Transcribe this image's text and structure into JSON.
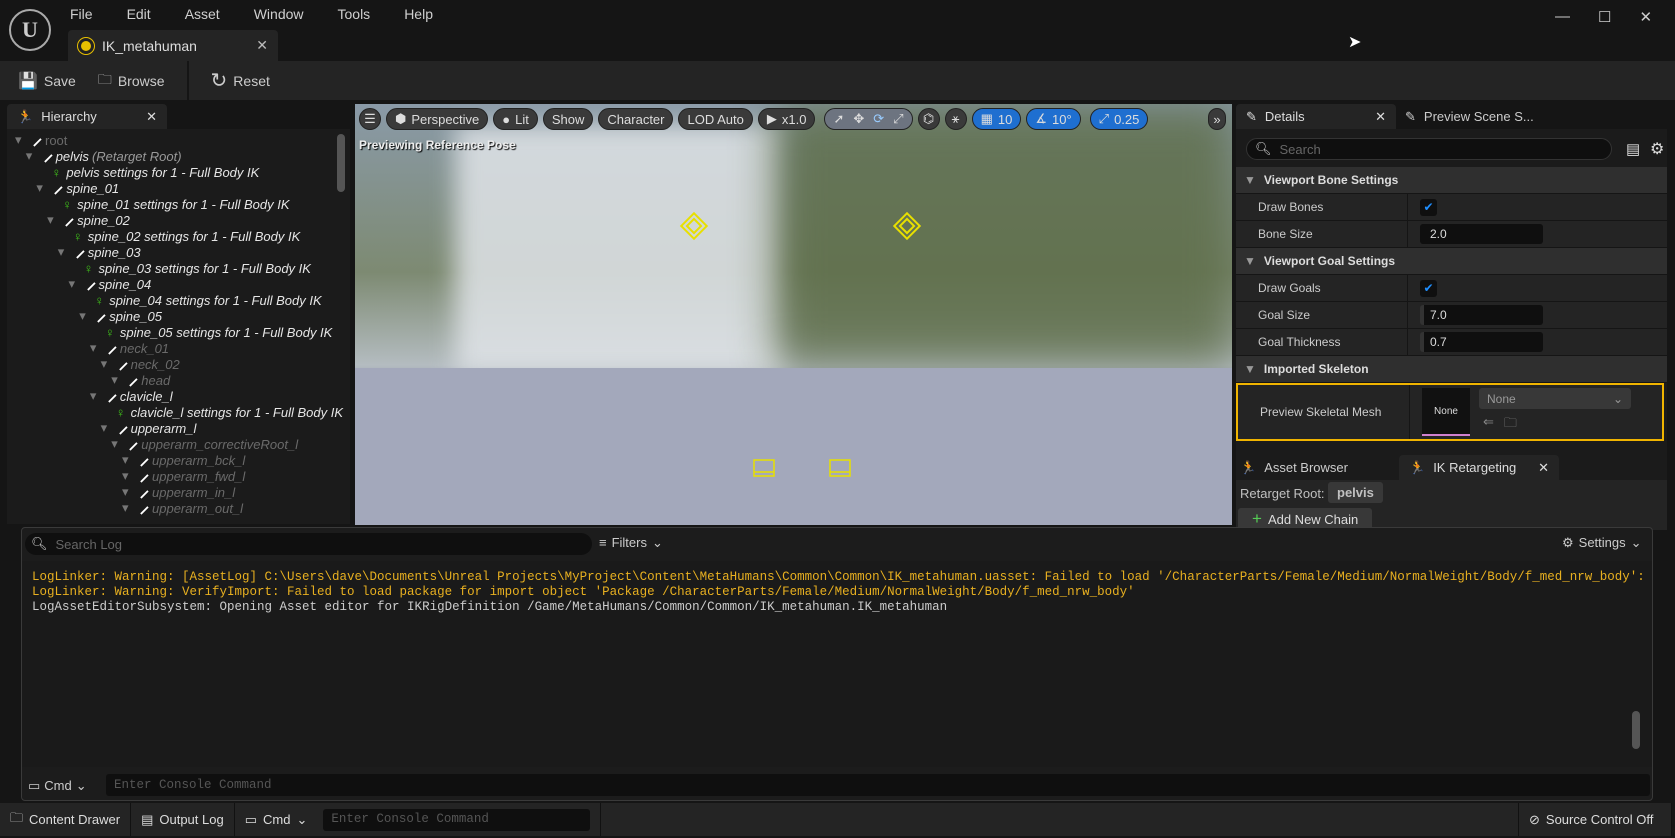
{
  "app": {
    "menu": [
      "File",
      "Edit",
      "Asset",
      "Window",
      "Tools",
      "Help"
    ],
    "tab_title": "IK_metahuman"
  },
  "toolbar": {
    "save": "Save",
    "browse": "Browse",
    "reset": "Reset"
  },
  "hierarchy": {
    "title": "Hierarchy",
    "items": [
      {
        "label": "root",
        "level": 0,
        "type": "bone",
        "dim": true,
        "style": "normal"
      },
      {
        "label": "pelvis",
        "suffix": "(Retarget Root)",
        "level": 1,
        "type": "bone"
      },
      {
        "label": "pelvis settings for 1 - Full Body IK",
        "level": 2,
        "type": "goal"
      },
      {
        "label": "spine_01",
        "level": 2,
        "type": "bone"
      },
      {
        "label": "spine_01 settings for 1 - Full Body IK",
        "level": 3,
        "type": "goal"
      },
      {
        "label": "spine_02",
        "level": 3,
        "type": "bone"
      },
      {
        "label": "spine_02 settings for 1 - Full Body IK",
        "level": 4,
        "type": "goal"
      },
      {
        "label": "spine_03",
        "level": 4,
        "type": "bone"
      },
      {
        "label": "spine_03 settings for 1 - Full Body IK",
        "level": 5,
        "type": "goal"
      },
      {
        "label": "spine_04",
        "level": 5,
        "type": "bone"
      },
      {
        "label": "spine_04 settings for 1 - Full Body IK",
        "level": 6,
        "type": "goal"
      },
      {
        "label": "spine_05",
        "level": 6,
        "type": "bone"
      },
      {
        "label": "spine_05 settings for 1 - Full Body IK",
        "level": 7,
        "type": "goal"
      },
      {
        "label": "neck_01",
        "level": 7,
        "type": "bone",
        "dim": true
      },
      {
        "label": "neck_02",
        "level": 8,
        "type": "bone",
        "dim": true
      },
      {
        "label": "head",
        "level": 9,
        "type": "bone",
        "dim": true
      },
      {
        "label": "clavicle_l",
        "level": 7,
        "type": "bone"
      },
      {
        "label": "clavicle_l settings for 1 - Full Body IK",
        "level": 8,
        "type": "goal"
      },
      {
        "label": "upperarm_l",
        "level": 8,
        "type": "bone"
      },
      {
        "label": "upperarm_correctiveRoot_l",
        "level": 9,
        "type": "bone",
        "dim": true
      },
      {
        "label": "upperarm_bck_l",
        "level": 10,
        "type": "bone",
        "dim": true
      },
      {
        "label": "upperarm_fwd_l",
        "level": 10,
        "type": "bone",
        "dim": true
      },
      {
        "label": "upperarm_in_l",
        "level": 10,
        "type": "bone",
        "dim": true
      },
      {
        "label": "upperarm_out_l",
        "level": 10,
        "type": "bone",
        "dim": true
      }
    ]
  },
  "viewport": {
    "perspective": "Perspective",
    "lit": "Lit",
    "show": "Show",
    "character": "Character",
    "lod": "LOD Auto",
    "speed": "x1.0",
    "grid_snap": "10",
    "rot_snap": "10°",
    "scale_snap": "0.25",
    "overlay": "Previewing Reference Pose",
    "gizmo_color": "#e8e000"
  },
  "details": {
    "tab": "Details",
    "tab2": "Preview Scene S...",
    "search_placeholder": "Search",
    "sections": {
      "bone": "Viewport Bone Settings",
      "goal": "Viewport Goal Settings",
      "skel": "Imported Skeleton"
    },
    "draw_bones": {
      "label": "Draw Bones",
      "checked": true
    },
    "bone_size": {
      "label": "Bone Size",
      "value": "2.0"
    },
    "draw_goals": {
      "label": "Draw Goals",
      "checked": true
    },
    "goal_size": {
      "label": "Goal Size",
      "value": "7.0"
    },
    "goal_thickness": {
      "label": "Goal Thickness",
      "value": "0.7"
    },
    "preview_mesh": {
      "label": "Preview Skeletal Mesh",
      "thumb": "None",
      "value": "None"
    },
    "highlight_color": "#f0b400"
  },
  "retarget": {
    "tab1": "Asset Browser",
    "tab2": "IK Retargeting",
    "root_label": "Retarget Root:",
    "root_value": "pelvis",
    "add_chain": "Add New Chain"
  },
  "output_log": {
    "search_placeholder": "Search Log",
    "filters": "Filters",
    "settings": "Settings",
    "lines": [
      {
        "text": "LogLinker: Warning: [AssetLog] C:\\Users\\dave\\Documents\\Unreal Projects\\MyProject\\Content\\MetaHumans\\Common\\Common\\IK_metahuman.uasset: Failed to load '/CharacterParts/Female/Medium/NormalWeight/Body/f_med_nrw_body': Can't find f:",
        "level": "warning"
      },
      {
        "text": "LogLinker: Warning: VerifyImport: Failed to load package for import object 'Package /CharacterParts/Female/Medium/NormalWeight/Body/f_med_nrw_body'",
        "level": "warning"
      },
      {
        "text": "LogAssetEditorSubsystem: Opening Asset editor for IKRigDefinition /Game/MetaHumans/Common/Common/IK_metahuman.IK_metahuman",
        "level": "info"
      }
    ],
    "cmd": "Cmd",
    "cmd_placeholder": "Enter Console Command"
  },
  "statusbar": {
    "content_drawer": "Content Drawer",
    "output_log": "Output Log",
    "cmd": "Cmd",
    "cmd_placeholder": "Enter Console Command",
    "source_control": "Source Control Off"
  }
}
